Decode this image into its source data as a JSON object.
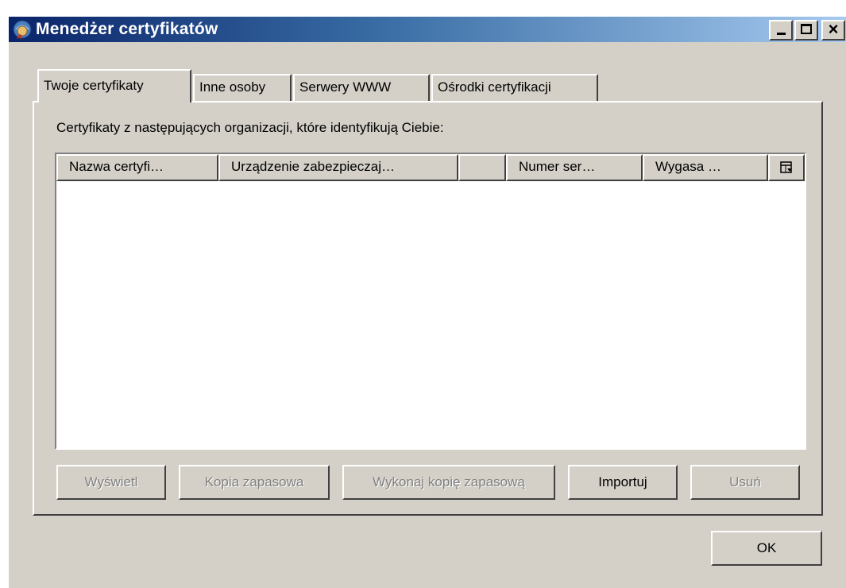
{
  "window": {
    "title": "Menedżer certyfikatów",
    "close_glyph": "×",
    "icons": {
      "app": "certificate-manager-app-icon",
      "minimize": "minimize-icon",
      "maximize": "maximize-icon",
      "close": "close-icon"
    }
  },
  "tabs": [
    {
      "label": "Twoje certyfikaty",
      "active": true
    },
    {
      "label": "Inne osoby",
      "active": false
    },
    {
      "label": "Serwery WWW",
      "active": false
    },
    {
      "label": "Ośrodki certyfikacji",
      "active": false
    }
  ],
  "panel": {
    "description": "Certyfikaty z następujących organizacji, które identyfikują Ciebie:"
  },
  "list": {
    "columns": [
      {
        "label": "Nazwa certyfi…"
      },
      {
        "label": "Urządzenie zabezpieczaj…"
      },
      {
        "label": ""
      },
      {
        "label": "Numer ser…"
      },
      {
        "label": "Wygasa …"
      }
    ],
    "column_picker_icon": "column-picker-icon",
    "rows": []
  },
  "buttons": {
    "view": "Wyświetl",
    "backup": "Kopia zapasowa",
    "backup_all": "Wykonaj kopię zapasową",
    "import": "Importuj",
    "delete": "Usuń",
    "ok": "OK"
  },
  "colors": {
    "titlebar_start": "#0a246a",
    "titlebar_end": "#a6caf0",
    "face": "#d4d0c8",
    "disabled_text": "#808080"
  }
}
